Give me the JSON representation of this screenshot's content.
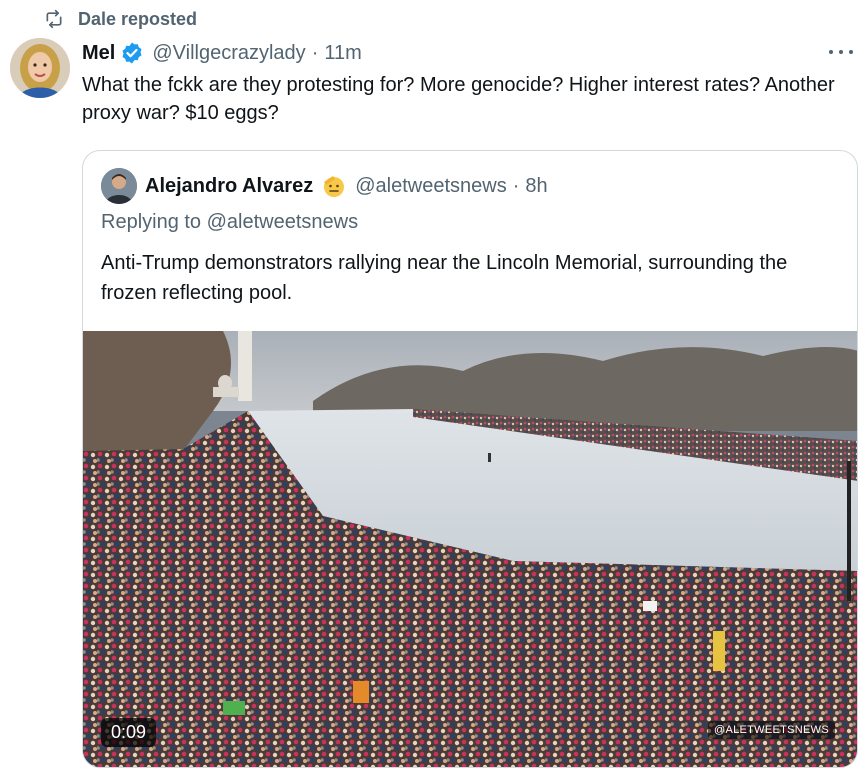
{
  "repost": {
    "label": "Dale reposted"
  },
  "tweet": {
    "name": "Mel",
    "handle": "@Villgecrazylady",
    "dot": "·",
    "time": "11m",
    "text": "What the fckk are they protesting for? More genocide? Higher interest rates? Another proxy war? $10 eggs?"
  },
  "quote": {
    "name": "Alejandro Alvarez",
    "handle": "@aletweetsnews",
    "dot": "·",
    "time": "8h",
    "replying_prefix": "Replying to ",
    "replying_to": "@aletweetsnews",
    "text": "Anti-Trump demonstrators rallying near the Lincoln Memorial, surrounding the frozen reflecting pool.",
    "video": {
      "duration": "0:09",
      "watermark": "@ALETWEETSNEWS"
    }
  },
  "colors": {
    "verified": "#1d9bf0",
    "secondary_text": "#536471",
    "border": "#cfd9de"
  },
  "icons": [
    "repost-icon",
    "verified-badge-icon",
    "more-icon",
    "saluting-face-emoji-icon"
  ]
}
